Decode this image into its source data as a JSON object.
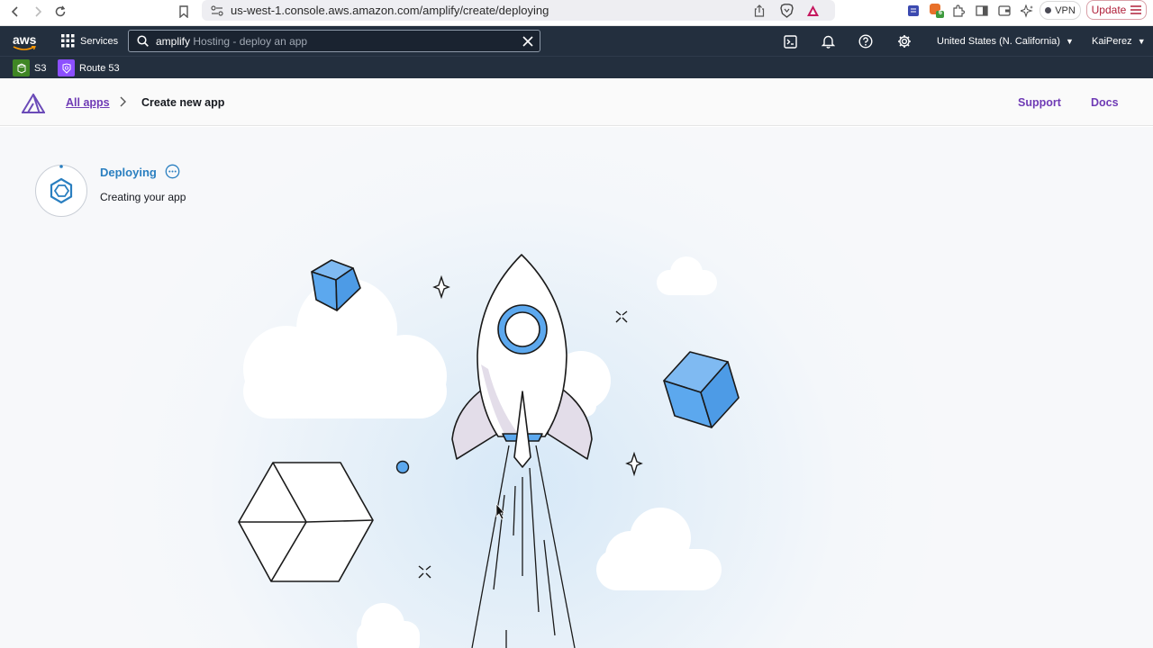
{
  "browser": {
    "url": "us-west-1.console.aws.amazon.com/amplify/create/deploying",
    "vpn_label": "VPN",
    "update_label": "Update",
    "extension_badge": "6"
  },
  "console": {
    "logo": "aws",
    "services_label": "Services",
    "search_value": "amplify",
    "search_hint": "Hosting - deploy an app",
    "region": "United States (N. California)",
    "user": "KaiPerez",
    "favorites": [
      {
        "label": "S3",
        "color": "#3f8624"
      },
      {
        "label": "Route 53",
        "color": "#8c4fff"
      }
    ]
  },
  "app_header": {
    "breadcrumb_root": "All apps",
    "breadcrumb_current": "Create new app",
    "support_label": "Support",
    "docs_label": "Docs"
  },
  "status": {
    "title": "Deploying",
    "subtitle": "Creating your app",
    "accent_color": "#2a7fc0"
  },
  "icons": [
    "back-icon",
    "forward-icon",
    "reload-icon",
    "bookmark-icon",
    "site-settings-icon",
    "share-icon",
    "brave-shield-icon",
    "brave-rewards-icon",
    "menu-icon",
    "grid-icon",
    "search-icon",
    "clear-icon",
    "cloudshell-icon",
    "notifications-icon",
    "help-icon",
    "settings-icon",
    "amplify-logo-icon",
    "more-icon",
    "rocket-illustration"
  ]
}
